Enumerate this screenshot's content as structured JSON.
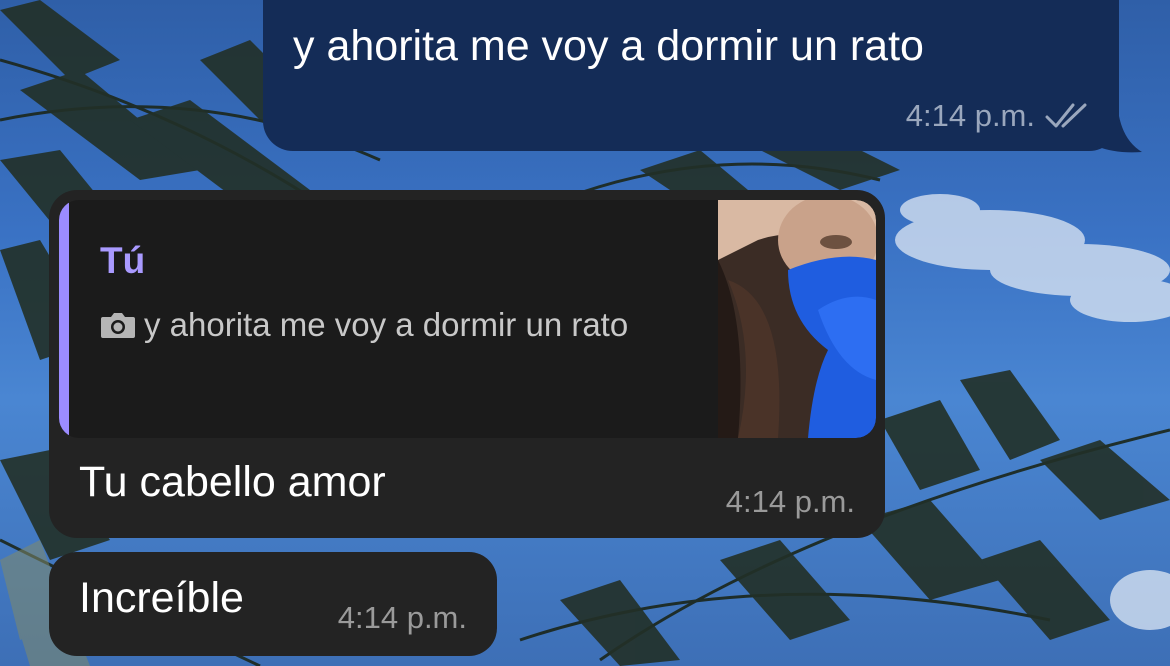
{
  "colors": {
    "outgoing_bubble": "#142c57",
    "incoming_bubble": "#232323",
    "quote_accent": "#9c8cff",
    "quote_author": "#a99aff",
    "read_ticks": "#9aa7bd"
  },
  "messages": [
    {
      "direction": "outgoing",
      "text": "y ahorita me voy a dormir un rato",
      "time": "4:14 p.m.",
      "status_icon": "double-check-icon"
    },
    {
      "direction": "incoming",
      "reply_to": {
        "author": "Tú",
        "icon": "camera-icon",
        "text": "y ahorita me voy a dormir un rato",
        "thumbnail": "photo-thumbnail"
      },
      "text": "Tu cabello amor",
      "time": "4:14 p.m."
    },
    {
      "direction": "incoming",
      "text": "Increíble",
      "time": "4:14 p.m."
    }
  ]
}
